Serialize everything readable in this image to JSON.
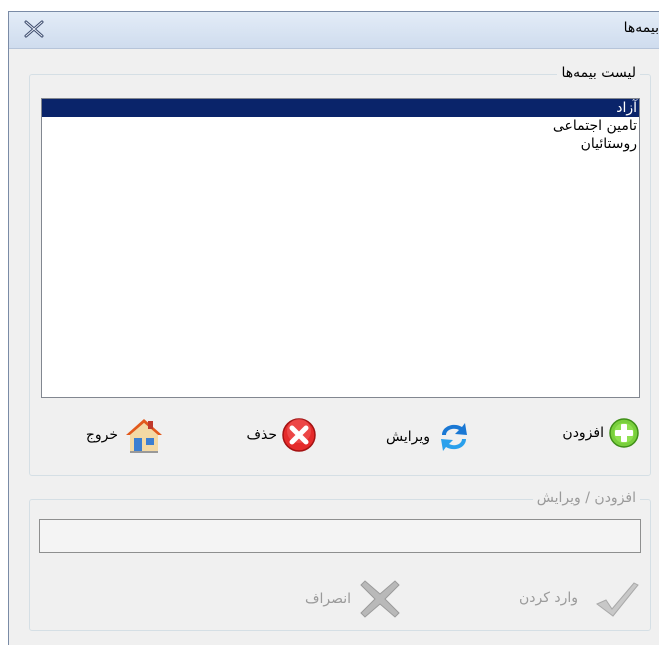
{
  "window": {
    "title": "بیمه‌ها"
  },
  "insurance_list": {
    "legend": "لیست بیمه‌ها",
    "items": [
      "آزاد",
      "تامین اجتماعی",
      "روستائیان"
    ],
    "selected_index": 0
  },
  "toolbar": {
    "add_label": "افزودن",
    "edit_label": "ویرایش",
    "delete_label": "حذف",
    "exit_label": "خروج"
  },
  "edit_group": {
    "legend": "افزودن / ویرایش",
    "input_value": "",
    "enter_label": "وارد کردن",
    "cancel_label": "انصراف"
  },
  "icons": {
    "close": "close-icon",
    "add": "plus-circle-icon",
    "edit": "refresh-arrows-icon",
    "delete": "x-circle-icon",
    "exit": "home-icon",
    "enter": "checkmark-icon",
    "cancel": "x-cross-icon"
  },
  "colors": {
    "selection": "#0a246a",
    "titlebar": "#d6e2f1",
    "add_green": "#5fbf2f",
    "delete_red": "#e52b2b",
    "edit_blue": "#1a78d4"
  }
}
